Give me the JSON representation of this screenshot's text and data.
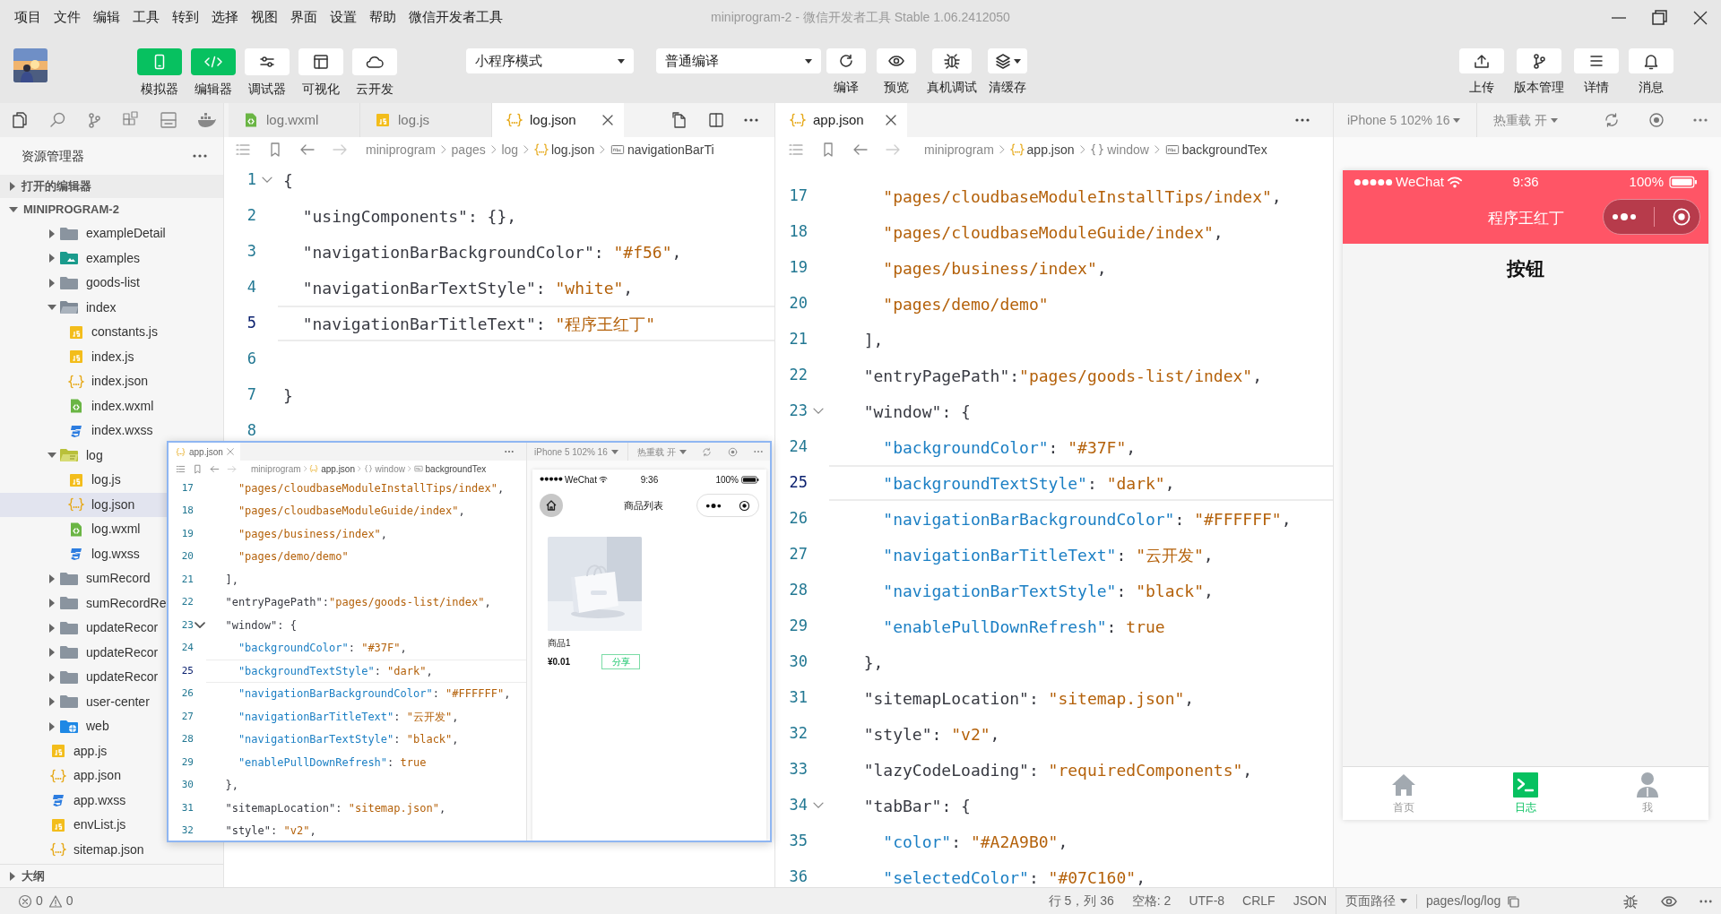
{
  "menu": [
    "项目",
    "文件",
    "编辑",
    "工具",
    "转到",
    "选择",
    "视图",
    "界面",
    "设置",
    "帮助",
    "微信开发者工具"
  ],
  "window": {
    "title": "miniprogram-2 - 微信开发者工具 Stable 1.06.2412050"
  },
  "toolbar": {
    "views": [
      {
        "label": "模拟器",
        "selected": true
      },
      {
        "label": "编辑器",
        "selected": true
      },
      {
        "label": "调试器",
        "selected": false
      },
      {
        "label": "可视化",
        "selected": false
      },
      {
        "label": "云开发",
        "selected": false
      }
    ],
    "mode": "小程序模式",
    "compile_mode": "普通编译",
    "actions": [
      "编译",
      "预览",
      "真机调试",
      "清缓存"
    ],
    "right": [
      "上传",
      "版本管理",
      "详情",
      "消息"
    ]
  },
  "explorer": {
    "title": "资源管理器",
    "sections": [
      {
        "label": "打开的编辑器",
        "expanded": false
      },
      {
        "label": "MINIPROGRAM-2",
        "expanded": true
      }
    ],
    "tree": [
      {
        "label": "exampleDetail",
        "kind": "folder",
        "expanded": false,
        "selected": false
      },
      {
        "label": "examples",
        "kind": "folder-media",
        "expanded": false,
        "selected": false
      },
      {
        "label": "goods-list",
        "kind": "folder",
        "expanded": false,
        "selected": false
      },
      {
        "label": "index",
        "kind": "folder",
        "expanded": true,
        "selected": false,
        "children": [
          {
            "label": "constants.js",
            "kind": "js",
            "selected": false
          },
          {
            "label": "index.js",
            "kind": "js",
            "selected": false
          },
          {
            "label": "index.json",
            "kind": "json",
            "selected": false
          },
          {
            "label": "index.wxml",
            "kind": "wxml",
            "selected": false
          },
          {
            "label": "index.wxss",
            "kind": "wxss",
            "selected": false
          }
        ]
      },
      {
        "label": "log",
        "kind": "folder-log",
        "expanded": true,
        "selected": false,
        "children": [
          {
            "label": "log.js",
            "kind": "js",
            "selected": false
          },
          {
            "label": "log.json",
            "kind": "json",
            "selected": true
          },
          {
            "label": "log.wxml",
            "kind": "wxml",
            "selected": false
          },
          {
            "label": "log.wxss",
            "kind": "wxss",
            "selected": false
          }
        ]
      },
      {
        "label": "sumRecord",
        "kind": "folder",
        "expanded": false,
        "selected": false
      },
      {
        "label": "sumRecordRe",
        "kind": "folder",
        "expanded": false,
        "selected": false
      },
      {
        "label": "updateRecor",
        "kind": "folder",
        "expanded": false,
        "selected": false
      },
      {
        "label": "updateRecor",
        "kind": "folder",
        "expanded": false,
        "selected": false
      },
      {
        "label": "updateRecor",
        "kind": "folder",
        "expanded": false,
        "selected": false
      },
      {
        "label": "user-center",
        "kind": "folder",
        "expanded": false,
        "selected": false
      },
      {
        "label": "web",
        "kind": "folder-web",
        "expanded": false,
        "selected": false
      }
    ],
    "root_files": [
      {
        "label": "app.js",
        "kind": "js",
        "selected": false
      },
      {
        "label": "app.json",
        "kind": "json",
        "selected": false
      },
      {
        "label": "app.wxss",
        "kind": "wxss",
        "selected": false
      },
      {
        "label": "envList.js",
        "kind": "js",
        "selected": false
      },
      {
        "label": "sitemap.json",
        "kind": "json",
        "selected": false
      }
    ],
    "outline": {
      "label": "大纲",
      "expanded": false
    }
  },
  "editor_left": {
    "tabs": [
      {
        "label": "log.wxml",
        "kind": "wxml",
        "selected": false
      },
      {
        "label": "log.js",
        "kind": "js",
        "selected": false
      },
      {
        "label": "log.json",
        "kind": "json",
        "selected": true
      }
    ],
    "breadcrumb": [
      {
        "label": "miniprogram",
        "kind": "folder"
      },
      {
        "label": "pages",
        "kind": "folder"
      },
      {
        "label": "log",
        "kind": "folder"
      },
      {
        "label": "log.json",
        "kind": "json"
      },
      {
        "label": "navigationBarTi",
        "kind": "string"
      }
    ],
    "lines": [
      {
        "n": "1",
        "current": false,
        "fold": true,
        "tokens": [
          {
            "kind": "p",
            "text": "{"
          }
        ]
      },
      {
        "n": "2",
        "current": false,
        "fold": false,
        "tokens": [
          {
            "kind": "key0",
            "text": "  \"usingComponents\""
          },
          {
            "kind": "p",
            "text": ": {},"
          }
        ]
      },
      {
        "n": "3",
        "current": false,
        "fold": false,
        "tokens": [
          {
            "kind": "key0",
            "text": "  \"navigationBarBackgroundColor\""
          },
          {
            "kind": "p",
            "text": ": "
          },
          {
            "kind": "str",
            "text": "\"#f56\""
          },
          {
            "kind": "p",
            "text": ","
          }
        ]
      },
      {
        "n": "4",
        "current": false,
        "fold": false,
        "tokens": [
          {
            "kind": "key0",
            "text": "  \"navigationBarTextStyle\""
          },
          {
            "kind": "p",
            "text": ": "
          },
          {
            "kind": "str",
            "text": "\"white\""
          },
          {
            "kind": "p",
            "text": ","
          }
        ]
      },
      {
        "n": "5",
        "current": true,
        "fold": false,
        "tokens": [
          {
            "kind": "key0",
            "text": "  \"navigationBarTitleText\""
          },
          {
            "kind": "p",
            "text": ": "
          },
          {
            "kind": "str",
            "text": "\"程序王红丁\""
          }
        ]
      },
      {
        "n": "6",
        "current": false,
        "fold": false
      },
      {
        "n": "7",
        "current": false,
        "fold": false,
        "tokens": [
          {
            "kind": "p",
            "text": "}"
          }
        ]
      },
      {
        "n": "8",
        "current": false,
        "fold": false
      }
    ]
  },
  "editor_right": {
    "tabs": [
      {
        "label": "app.json",
        "kind": "json",
        "selected": true
      }
    ],
    "breadcrumb": [
      {
        "label": "miniprogram",
        "kind": "folder"
      },
      {
        "label": "app.json",
        "kind": "json"
      },
      {
        "label": "window",
        "kind": "object"
      },
      {
        "label": "backgroundTex",
        "kind": "string"
      }
    ],
    "lines": [
      {
        "n": "17",
        "current": false,
        "fold": false,
        "tokens": [
          {
            "kind": "str",
            "text": "    \"pages/cloudbaseModuleInstallTips/index\""
          },
          {
            "kind": "p",
            "text": ","
          }
        ]
      },
      {
        "n": "18",
        "current": false,
        "fold": false,
        "tokens": [
          {
            "kind": "str",
            "text": "    \"pages/cloudbaseModuleGuide/index\""
          },
          {
            "kind": "p",
            "text": ","
          }
        ]
      },
      {
        "n": "19",
        "current": false,
        "fold": false,
        "tokens": [
          {
            "kind": "str",
            "text": "    \"pages/business/index\""
          },
          {
            "kind": "p",
            "text": ","
          }
        ]
      },
      {
        "n": "20",
        "current": false,
        "fold": false,
        "tokens": [
          {
            "kind": "str",
            "text": "    \"pages/demo/demo\""
          }
        ]
      },
      {
        "n": "21",
        "current": false,
        "fold": false,
        "tokens": [
          {
            "kind": "p",
            "text": "  ],"
          }
        ]
      },
      {
        "n": "22",
        "current": false,
        "fold": false,
        "tokens": [
          {
            "kind": "key0",
            "text": "  \"entryPagePath\""
          },
          {
            "kind": "p",
            "text": ":"
          },
          {
            "kind": "str",
            "text": "\"pages/goods-list/index\""
          },
          {
            "kind": "p",
            "text": ","
          }
        ]
      },
      {
        "n": "23",
        "current": false,
        "fold": true,
        "tokens": [
          {
            "kind": "key0",
            "text": "  \"window\""
          },
          {
            "kind": "p",
            "text": ": {"
          }
        ]
      },
      {
        "n": "24",
        "current": false,
        "fold": false,
        "tokens": [
          {
            "kind": "key",
            "text": "    \"backgroundColor\""
          },
          {
            "kind": "p",
            "text": ": "
          },
          {
            "kind": "str",
            "text": "\"#37F\""
          },
          {
            "kind": "p",
            "text": ","
          }
        ]
      },
      {
        "n": "25",
        "current": true,
        "fold": false,
        "tokens": [
          {
            "kind": "key",
            "text": "    \"backgroundTextStyle\""
          },
          {
            "kind": "p",
            "text": ": "
          },
          {
            "kind": "str",
            "text": "\"dark\""
          },
          {
            "kind": "p",
            "text": ","
          }
        ]
      },
      {
        "n": "26",
        "current": false,
        "fold": false,
        "tokens": [
          {
            "kind": "key",
            "text": "    \"navigationBarBackgroundColor\""
          },
          {
            "kind": "p",
            "text": ": "
          },
          {
            "kind": "str",
            "text": "\"#FFFFFF\""
          },
          {
            "kind": "p",
            "text": ","
          }
        ]
      },
      {
        "n": "27",
        "current": false,
        "fold": false,
        "tokens": [
          {
            "kind": "key",
            "text": "    \"navigationBarTitleText\""
          },
          {
            "kind": "p",
            "text": ": "
          },
          {
            "kind": "str",
            "text": "\"云开发\""
          },
          {
            "kind": "p",
            "text": ","
          }
        ]
      },
      {
        "n": "28",
        "current": false,
        "fold": false,
        "tokens": [
          {
            "kind": "key",
            "text": "    \"navigationBarTextStyle\""
          },
          {
            "kind": "p",
            "text": ": "
          },
          {
            "kind": "str",
            "text": "\"black\""
          },
          {
            "kind": "p",
            "text": ","
          }
        ]
      },
      {
        "n": "29",
        "current": false,
        "fold": false,
        "tokens": [
          {
            "kind": "key",
            "text": "    \"enablePullDownRefresh\""
          },
          {
            "kind": "p",
            "text": ": "
          },
          {
            "kind": "str",
            "text": "true"
          }
        ]
      },
      {
        "n": "30",
        "current": false,
        "fold": false,
        "tokens": [
          {
            "kind": "p",
            "text": "  },"
          }
        ]
      },
      {
        "n": "31",
        "current": false,
        "fold": false,
        "tokens": [
          {
            "kind": "key0",
            "text": "  \"sitemapLocation\""
          },
          {
            "kind": "p",
            "text": ": "
          },
          {
            "kind": "str",
            "text": "\"sitemap.json\""
          },
          {
            "kind": "p",
            "text": ","
          }
        ]
      },
      {
        "n": "32",
        "current": false,
        "fold": false,
        "tokens": [
          {
            "kind": "key0",
            "text": "  \"style\""
          },
          {
            "kind": "p",
            "text": ": "
          },
          {
            "kind": "str",
            "text": "\"v2\""
          },
          {
            "kind": "p",
            "text": ","
          }
        ]
      },
      {
        "n": "33",
        "current": false,
        "fold": false,
        "tokens": [
          {
            "kind": "key0",
            "text": "  \"lazyCodeLoading\""
          },
          {
            "kind": "p",
            "text": ": "
          },
          {
            "kind": "str",
            "text": "\"requiredComponents\""
          },
          {
            "kind": "p",
            "text": ","
          }
        ]
      },
      {
        "n": "34",
        "current": false,
        "fold": true,
        "tokens": [
          {
            "kind": "key0",
            "text": "  \"tabBar\""
          },
          {
            "kind": "p",
            "text": ": {"
          }
        ]
      },
      {
        "n": "35",
        "current": false,
        "fold": false,
        "tokens": [
          {
            "kind": "key",
            "text": "    \"color\""
          },
          {
            "kind": "p",
            "text": ": "
          },
          {
            "kind": "str",
            "text": "\"#A2A9B0\""
          },
          {
            "kind": "p",
            "text": ","
          }
        ]
      },
      {
        "n": "36",
        "current": false,
        "fold": false,
        "tokens": [
          {
            "kind": "key",
            "text": "    \"selectedColor\""
          },
          {
            "kind": "p",
            "text": ": "
          },
          {
            "kind": "str",
            "text": "\"#07C160\""
          },
          {
            "kind": "p",
            "text": ","
          }
        ]
      }
    ]
  },
  "simulator": {
    "device": "iPhone 5 102% 16",
    "hot_reload": "热重载 开",
    "phone": {
      "carrier": "WeChat",
      "time": "9:36",
      "battery": "100%",
      "title": "程序王红丁",
      "content": "按钮",
      "tabs": [
        {
          "label": "首页",
          "selected": false
        },
        {
          "label": "日志",
          "selected": true
        },
        {
          "label": "我",
          "selected": false
        }
      ]
    }
  },
  "preview_popup": {
    "tab": "app.json",
    "device": "iPhone 5 102% 16",
    "hot_reload": "热重载 开",
    "breadcrumb": [
      {
        "label": "miniprogram",
        "kind": "folder"
      },
      {
        "label": "app.json",
        "kind": "json"
      },
      {
        "label": "window",
        "kind": "object"
      },
      {
        "label": "backgroundTex",
        "kind": "string"
      }
    ],
    "lines": [
      {
        "n": "17",
        "current": false,
        "fold": false,
        "tokens": [
          {
            "kind": "str",
            "text": "    \"pages/cloudbaseModuleInstallTips/index\""
          },
          {
            "kind": "p",
            "text": ","
          }
        ]
      },
      {
        "n": "18",
        "current": false,
        "fold": false,
        "tokens": [
          {
            "kind": "str",
            "text": "    \"pages/cloudbaseModuleGuide/index\""
          },
          {
            "kind": "p",
            "text": ","
          }
        ]
      },
      {
        "n": "19",
        "current": false,
        "fold": false,
        "tokens": [
          {
            "kind": "str",
            "text": "    \"pages/business/index\""
          },
          {
            "kind": "p",
            "text": ","
          }
        ]
      },
      {
        "n": "20",
        "current": false,
        "fold": false,
        "tokens": [
          {
            "kind": "str",
            "text": "    \"pages/demo/demo\""
          }
        ]
      },
      {
        "n": "21",
        "current": false,
        "fold": false,
        "tokens": [
          {
            "kind": "p",
            "text": "  ],"
          }
        ]
      },
      {
        "n": "22",
        "current": false,
        "fold": false,
        "tokens": [
          {
            "kind": "key0",
            "text": "  \"entryPagePath\""
          },
          {
            "kind": "p",
            "text": ":"
          },
          {
            "kind": "str",
            "text": "\"pages/goods-list/index\""
          },
          {
            "kind": "p",
            "text": ","
          }
        ]
      },
      {
        "n": "23",
        "current": false,
        "fold": true,
        "tokens": [
          {
            "kind": "key0",
            "text": "  \"window\""
          },
          {
            "kind": "p",
            "text": ": {"
          }
        ]
      },
      {
        "n": "24",
        "current": false,
        "fold": false,
        "tokens": [
          {
            "kind": "key",
            "text": "    \"backgroundColor\""
          },
          {
            "kind": "p",
            "text": ": "
          },
          {
            "kind": "str",
            "text": "\"#37F\""
          },
          {
            "kind": "p",
            "text": ","
          }
        ]
      },
      {
        "n": "25",
        "current": true,
        "fold": false,
        "tokens": [
          {
            "kind": "key",
            "text": "    \"backgroundTextStyle\""
          },
          {
            "kind": "p",
            "text": ": "
          },
          {
            "kind": "str",
            "text": "\"dark\""
          },
          {
            "kind": "p",
            "text": ","
          }
        ]
      },
      {
        "n": "26",
        "current": false,
        "fold": false,
        "tokens": [
          {
            "kind": "key",
            "text": "    \"navigationBarBackgroundColor\""
          },
          {
            "kind": "p",
            "text": ": "
          },
          {
            "kind": "str",
            "text": "\"#FFFFFF\""
          },
          {
            "kind": "p",
            "text": ","
          }
        ]
      },
      {
        "n": "27",
        "current": false,
        "fold": false,
        "tokens": [
          {
            "kind": "key",
            "text": "    \"navigationBarTitleText\""
          },
          {
            "kind": "p",
            "text": ": "
          },
          {
            "kind": "str",
            "text": "\"云开发\""
          },
          {
            "kind": "p",
            "text": ","
          }
        ]
      },
      {
        "n": "28",
        "current": false,
        "fold": false,
        "tokens": [
          {
            "kind": "key",
            "text": "    \"navigationBarTextStyle\""
          },
          {
            "kind": "p",
            "text": ": "
          },
          {
            "kind": "str",
            "text": "\"black\""
          },
          {
            "kind": "p",
            "text": ","
          }
        ]
      },
      {
        "n": "29",
        "current": false,
        "fold": false,
        "tokens": [
          {
            "kind": "key",
            "text": "    \"enablePullDownRefresh\""
          },
          {
            "kind": "p",
            "text": ": "
          },
          {
            "kind": "str",
            "text": "true"
          }
        ]
      },
      {
        "n": "30",
        "current": false,
        "fold": false,
        "tokens": [
          {
            "kind": "p",
            "text": "  },"
          }
        ]
      },
      {
        "n": "31",
        "current": false,
        "fold": false,
        "tokens": [
          {
            "kind": "key0",
            "text": "  \"sitemapLocation\""
          },
          {
            "kind": "p",
            "text": ": "
          },
          {
            "kind": "str",
            "text": "\"sitemap.json\""
          },
          {
            "kind": "p",
            "text": ","
          }
        ]
      },
      {
        "n": "32",
        "current": false,
        "fold": false,
        "tokens": [
          {
            "kind": "key0",
            "text": "  \"style\""
          },
          {
            "kind": "p",
            "text": ": "
          },
          {
            "kind": "str",
            "text": "\"v2\""
          },
          {
            "kind": "p",
            "text": ","
          }
        ]
      }
    ],
    "phone": {
      "carrier": "WeChat",
      "time": "9:36",
      "battery": "100%",
      "title": "商品列表",
      "product": {
        "name": "商品1",
        "price": "¥0.01",
        "action": "分享"
      }
    }
  },
  "status_bar": {
    "errors": "0",
    "warnings": "0",
    "items": [
      "行 5，列 36",
      "空格: 2",
      "UTF-8",
      "CRLF",
      "JSON"
    ],
    "page_path_label": "页面路径",
    "page_path": "pages/log/log"
  }
}
